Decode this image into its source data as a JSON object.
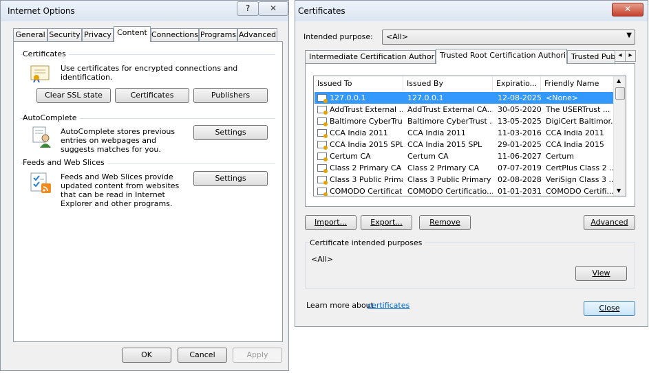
{
  "internet_options": {
    "title": "Internet Options",
    "help_glyph": "?",
    "close_glyph": "✕",
    "tabs": [
      {
        "label": "General"
      },
      {
        "label": "Security"
      },
      {
        "label": "Privacy"
      },
      {
        "label": "Content"
      },
      {
        "label": "Connections"
      },
      {
        "label": "Programs"
      },
      {
        "label": "Advanced"
      }
    ],
    "active_tab": "Content",
    "certificates": {
      "heading": "Certificates",
      "description": "Use certificates for encrypted connections and identification.",
      "clear_ssl_label": "Clear SSL state",
      "certificates_label": "Certificates",
      "publishers_label": "Publishers"
    },
    "autocomplete": {
      "heading": "AutoComplete",
      "description": "AutoComplete stores previous entries on webpages and suggests matches for you.",
      "settings_label": "Settings"
    },
    "feeds": {
      "heading": "Feeds and Web Slices",
      "description": "Feeds and Web Slices provide updated content from websites that can be read in Internet Explorer and other programs.",
      "settings_label": "Settings"
    },
    "footer": {
      "ok_label": "OK",
      "cancel_label": "Cancel",
      "apply_label": "Apply"
    }
  },
  "certificates_dialog": {
    "title": "Certificates",
    "close_glyph": "✕",
    "intended_purpose_label": "Intended purpose:",
    "intended_purpose_value": "<All>",
    "tabs": [
      {
        "label": "Intermediate Certification Authorities"
      },
      {
        "label": "Trusted Root Certification Authorities"
      },
      {
        "label": "Trusted Publ"
      }
    ],
    "tab_scroll_left": "◂",
    "tab_scroll_right": "▸",
    "columns": [
      "Issued To",
      "Issued By",
      "Expiratio...",
      "Friendly Name"
    ],
    "rows": [
      {
        "issued_to": "127.0.0.1",
        "issued_by": "127.0.0.1",
        "expiration": "12-08-2025",
        "friendly": "<None>",
        "selected": true
      },
      {
        "issued_to": "AddTrust External ...",
        "issued_by": "AddTrust External CA...",
        "expiration": "30-05-2020",
        "friendly": "The USERTrust ..."
      },
      {
        "issued_to": "Baltimore CyberTru...",
        "issued_by": "Baltimore CyberTrust ...",
        "expiration": "13-05-2025",
        "friendly": "DigiCert Baltimor..."
      },
      {
        "issued_to": "CCA India 2011",
        "issued_by": "CCA India 2011",
        "expiration": "11-03-2016",
        "friendly": "CCA India 2011"
      },
      {
        "issued_to": "CCA India 2015 SPL",
        "issued_by": "CCA India 2015 SPL",
        "expiration": "29-01-2025",
        "friendly": "CCA India 2015"
      },
      {
        "issued_to": "Certum CA",
        "issued_by": "Certum CA",
        "expiration": "11-06-2027",
        "friendly": "Certum"
      },
      {
        "issued_to": "Class 2 Primary CA",
        "issued_by": "Class 2 Primary CA",
        "expiration": "07-07-2019",
        "friendly": "CertPlus Class 2 ..."
      },
      {
        "issued_to": "Class 3 Public Prima...",
        "issued_by": "Class 3 Public Primary ...",
        "expiration": "02-08-2028",
        "friendly": "VeriSign Class 3 ..."
      },
      {
        "issued_to": "COMODO Certificat...",
        "issued_by": "COMODO Certificatio...",
        "expiration": "01-01-2031",
        "friendly": "COMODO Certifi..."
      }
    ],
    "import_label": "Import...",
    "export_label": "Export...",
    "remove_label": "Remove",
    "advanced_label": "Advanced",
    "purposes_heading": "Certificate intended purposes",
    "purposes_value": "<All>",
    "view_label": "View",
    "learn_more_prefix": "Learn more about",
    "learn_more_link": "certificates",
    "close_label": "Close"
  }
}
